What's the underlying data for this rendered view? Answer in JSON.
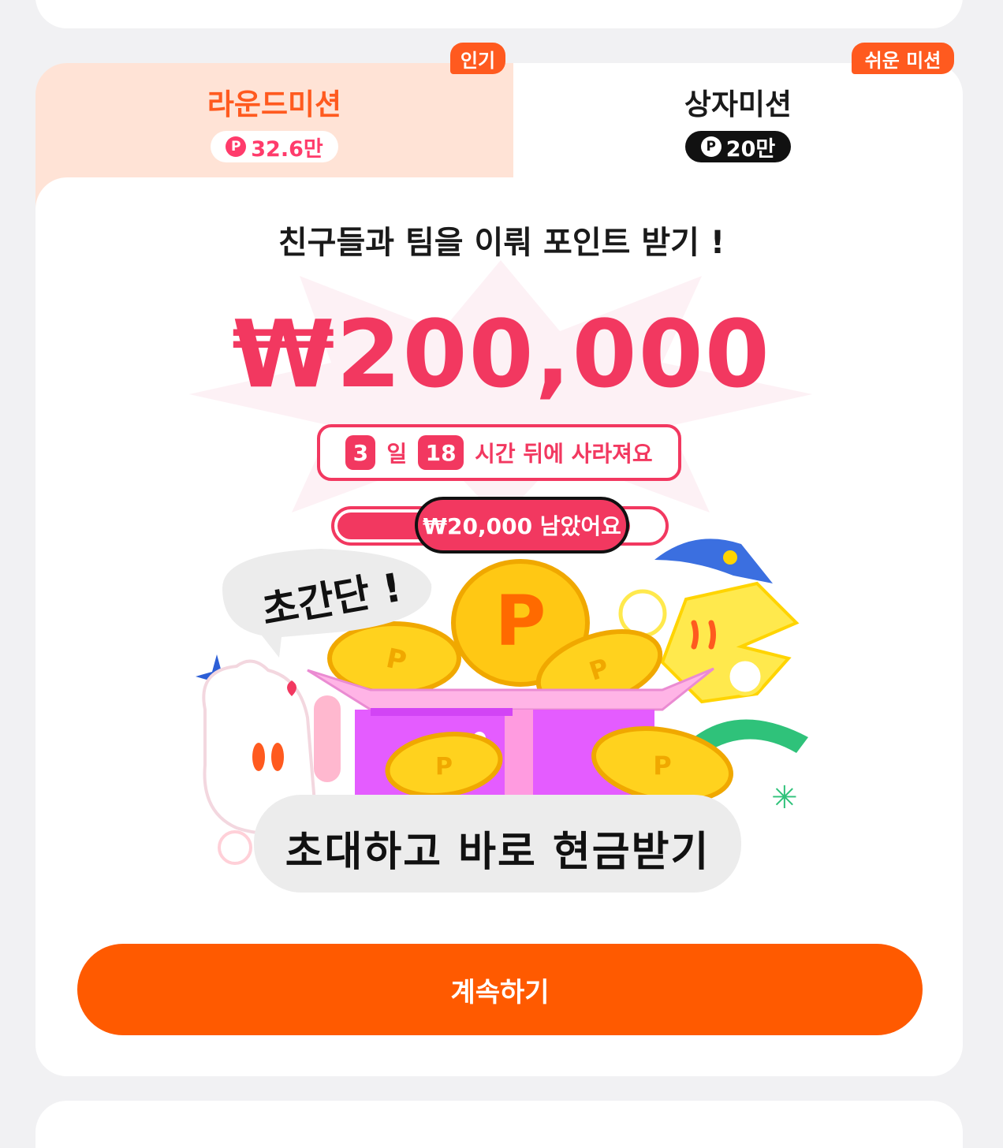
{
  "tabs": [
    {
      "label": "라운드미션",
      "points": "32.6만",
      "badge": "인기",
      "active": true
    },
    {
      "label": "상자미션",
      "points": "20만",
      "badge": "쉬운 미션",
      "active": false
    }
  ],
  "point_symbol": "P",
  "mission": {
    "headline": "친구들과 팀을 이뤄 포인트 받기 !",
    "amount": "₩200,000",
    "timer": {
      "days": "3",
      "days_unit": "일",
      "hours": "18",
      "suffix": "시간 뒤에 사라져요"
    },
    "progress": {
      "fraction": 0.9,
      "remaining_text": "₩20,000 남았어요"
    },
    "illustration": {
      "bubble_easy": "초간단 !",
      "bubble_cash": "초대하고 바로 현금받기",
      "coin_letter": "P"
    },
    "continue_label": "계속하기"
  },
  "colors": {
    "accent_orange": "#ff5a00",
    "accent_pink": "#f23860",
    "tab_active_bg": "#ffe3d6",
    "page_bg": "#f1f1f3"
  }
}
